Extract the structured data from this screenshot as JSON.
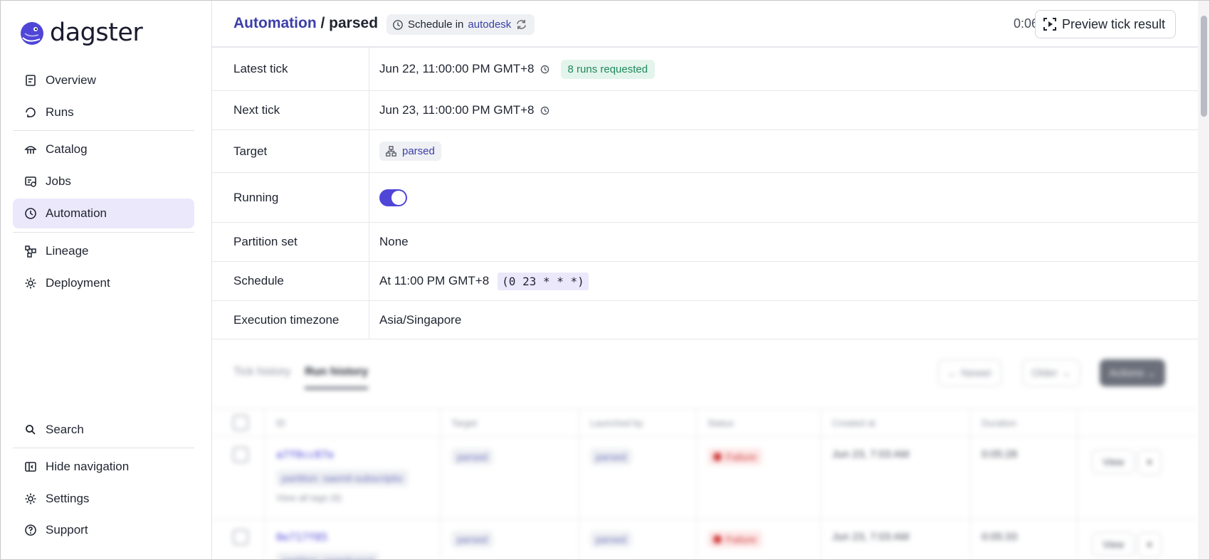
{
  "sidebar": {
    "logo_text": "dagster",
    "items": [
      {
        "label": "Overview",
        "icon": "overview-icon"
      },
      {
        "label": "Runs",
        "icon": "runs-icon"
      },
      {
        "label": "Catalog",
        "icon": "catalog-icon"
      },
      {
        "label": "Jobs",
        "icon": "jobs-icon"
      },
      {
        "label": "Automation",
        "icon": "automation-icon",
        "active": true
      },
      {
        "label": "Lineage",
        "icon": "lineage-icon"
      },
      {
        "label": "Deployment",
        "icon": "deployment-icon"
      }
    ],
    "bottom_items": [
      {
        "label": "Search",
        "icon": "search-icon"
      },
      {
        "label": "Hide navigation",
        "icon": "hide-navigation-icon"
      },
      {
        "label": "Settings",
        "icon": "settings-icon"
      },
      {
        "label": "Support",
        "icon": "support-icon"
      }
    ]
  },
  "header": {
    "breadcrumb_link": "Automation",
    "breadcrumb_sep": " / ",
    "breadcrumb_current": "parsed",
    "schedule_prefix": "Schedule in",
    "schedule_location": "autodesk",
    "timer": "0:06",
    "preview_button": "Preview tick result"
  },
  "details": {
    "latest_tick": {
      "label": "Latest tick",
      "value": "Jun 22, 11:00:00 PM GMT+8",
      "badge": "8 runs requested"
    },
    "next_tick": {
      "label": "Next tick",
      "value": "Jun 23, 11:00:00 PM GMT+8"
    },
    "target": {
      "label": "Target",
      "value": "parsed"
    },
    "running": {
      "label": "Running",
      "on": true
    },
    "partition_set": {
      "label": "Partition set",
      "value": "None"
    },
    "schedule": {
      "label": "Schedule",
      "value": "At 11:00 PM GMT+8",
      "cron": "(0 23 * * *)"
    },
    "timezone": {
      "label": "Execution timezone",
      "value": "Asia/Singapore"
    }
  },
  "history": {
    "tabs": [
      "Tick history",
      "Run history"
    ],
    "active_tab": "Run history",
    "newer": "Newer",
    "older": "Older",
    "actions": "Actions",
    "columns": [
      "ID",
      "Target",
      "Launched by",
      "Status",
      "Created at",
      "Duration"
    ],
    "rows": [
      {
        "id": "a7f0cc07e",
        "tag": "partition: saemil-subscriptio",
        "view_tags": "View all tags (6)",
        "target": "parsed",
        "launched_by": "parsed",
        "status": "Failure",
        "created": "Jun 23, 7:03 AM",
        "duration": "0:05:28",
        "view": "View"
      },
      {
        "id": "0e717f85",
        "tag": "partition: saemil-sout",
        "target": "parsed",
        "launched_by": "parsed",
        "status": "Failure",
        "created": "Jun 23, 7:03 AM",
        "duration": "0:05:33",
        "view": "View"
      }
    ]
  },
  "colors": {
    "accent": "#4f46d8",
    "active_bg": "#ebe8fb",
    "success": "#1f8a5b",
    "failure": "#d13a3a"
  }
}
